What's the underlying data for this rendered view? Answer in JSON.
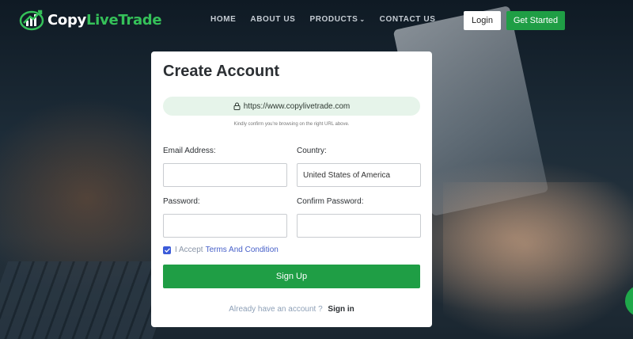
{
  "brand": {
    "name_part1": "Copy",
    "name_part2": "LiveTrade",
    "accent_color": "#35c159"
  },
  "nav": {
    "links": [
      "HOME",
      "ABOUT US",
      "PRODUCTS",
      "CONTACT US"
    ],
    "products_icon": "chevron-down-icon",
    "login_label": "Login",
    "get_started_label": "Get Started"
  },
  "form": {
    "title": "Create Account",
    "url_display": "https://www.copylivetrade.com",
    "url_icon": "lock-icon",
    "url_note": "Kindly confirm you're browsing on the right URL above.",
    "email_label": "Email Address:",
    "email_value": "",
    "country_label": "Country:",
    "country_value": "United States of America",
    "password_label": "Password:",
    "password_value": "",
    "confirm_password_label": "Confirm Password:",
    "confirm_password_value": "",
    "accept_checked": true,
    "accept_prefix": "I Accept",
    "terms_link": "Terms And Condition",
    "submit_label": "Sign Up",
    "already_text": "Already have an account ?",
    "signin_link": "Sign in"
  },
  "colors": {
    "primary_green": "#1f9e45",
    "checkbox_blue": "#3b5bd9",
    "url_pill_bg": "#e6f4ea"
  }
}
